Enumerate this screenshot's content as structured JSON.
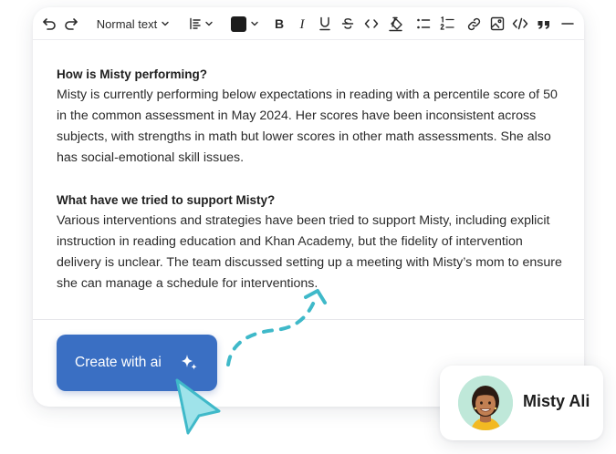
{
  "toolbar": {
    "block_style": "Normal text",
    "text_color": "#1c1c1c"
  },
  "sections": [
    {
      "heading": "How is Misty performing?",
      "body": " Misty is currently performing below expectations in reading with a percentile score of 50 in the common assessment in May 2024. Her scores have been inconsistent across subjects, with strengths in math but lower scores in other math assessments. She also has social-emotional skill issues."
    },
    {
      "heading": "What have we tried to support Misty?",
      "body": " Various interventions and strategies have been tried to support Misty, including explicit instruction in reading education and Khan Academy, but the fidelity of intervention delivery is unclear. The team discussed setting up a meeting with Misty’s mom to ensure she can manage a schedule for interventions."
    }
  ],
  "create_button": {
    "label": "Create with ai"
  },
  "user": {
    "name": "Misty Ali"
  },
  "colors": {
    "accent": "#3a6fc3",
    "cursor": "#9fe3ea",
    "arrow": "#3fb9c9"
  }
}
